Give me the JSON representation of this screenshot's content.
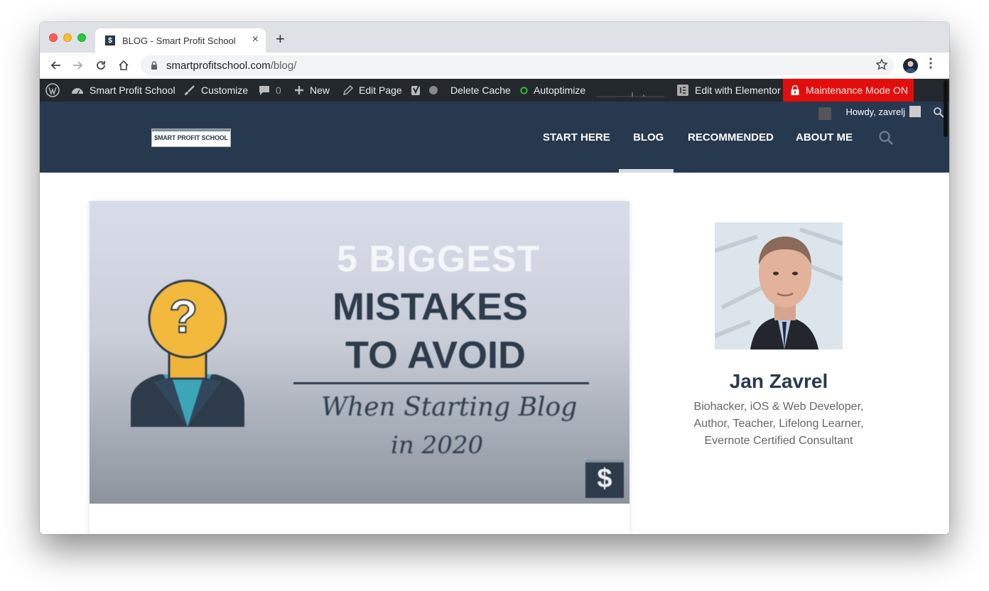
{
  "browser": {
    "tab_title": "BLOG - Smart Profit School",
    "tab_favicon": "$",
    "tab_close": "×",
    "new_tab": "+",
    "url_host": "smartprofitschool.com",
    "url_path": "/blog/"
  },
  "adminbar": {
    "site_name": "Smart Profit School",
    "customize": "Customize",
    "comments_count": "0",
    "new": "New",
    "edit_page": "Edit Page",
    "delete_cache": "Delete Cache",
    "autoptimize": "Autoptimize",
    "edit_elementor": "Edit with Elementor",
    "maintenance": "Maintenance Mode ON",
    "howdy": "Howdy, zavrelj"
  },
  "site": {
    "logo_text": "$MART PROFIT SCHOOL",
    "nav": [
      {
        "label": "START HERE"
      },
      {
        "label": "BLOG"
      },
      {
        "label": "RECOMMENDED"
      },
      {
        "label": "ABOUT ME"
      }
    ],
    "active_nav": "BLOG"
  },
  "featured_image": {
    "line1": "5 BIGGEST",
    "line2": "MISTAKES",
    "line3": "TO AVOID",
    "script1": "When Starting Blog",
    "script2": "in 2020",
    "badge": "$",
    "question_mark": "?"
  },
  "sidebar": {
    "author_name": "Jan Zavrel",
    "bio_line1": "Biohacker, iOS & Web Developer,",
    "bio_line2": "Author, Teacher, Lifelong Learner,",
    "bio_line3": "Evernote Certified Consultant"
  },
  "colors": {
    "header_bg": "#27394f",
    "adminbar_bg": "#23282d",
    "maintenance_bg": "#e30d0d",
    "autoptimize_status": "#2ecc40"
  },
  "icons": {
    "back": "arrow-left-icon",
    "forward": "arrow-right-icon",
    "reload": "reload-icon",
    "home": "home-icon",
    "lock": "lock-icon",
    "bookmark": "star-icon",
    "menu": "kebab-icon",
    "search": "search-icon"
  }
}
